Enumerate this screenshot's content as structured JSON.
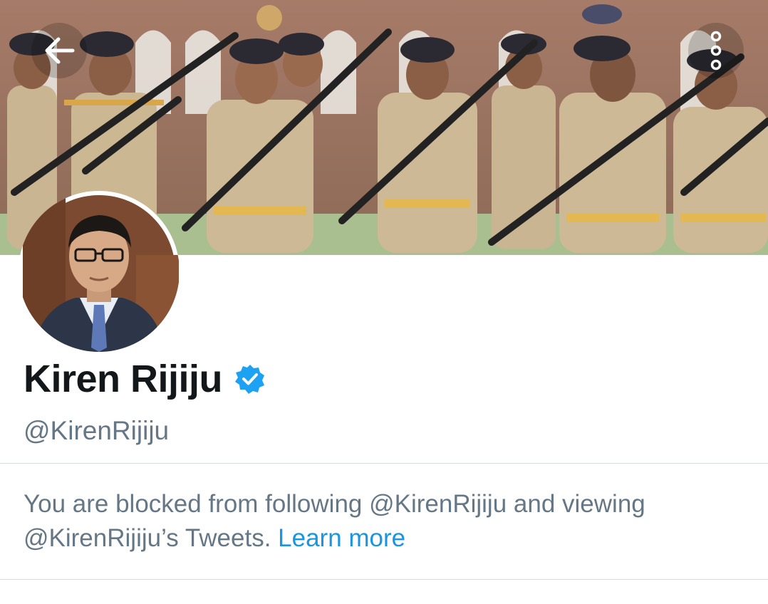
{
  "header": {
    "back_icon": "arrow-left-icon",
    "more_icon": "more-vertical-icon",
    "banner_description_colors": {
      "sky": "#9c7a63",
      "uniform": "#c8b48e",
      "beret": "#2b2a33",
      "ground": "#a7c08f"
    }
  },
  "profile": {
    "display_name": "Kiren Rijiju",
    "handle": "@KirenRijiju",
    "verified_icon": "verified-badge-icon",
    "verified_color": "#1da1f2"
  },
  "blocked_notice": {
    "text": "You are blocked from following @KirenRijiju and viewing @KirenRijiju’s Tweets.",
    "link_label": "Learn more",
    "link_color": "#1b95e0"
  }
}
